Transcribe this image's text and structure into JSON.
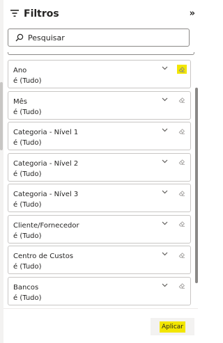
{
  "header": {
    "title": "Filtros",
    "collapse_icon": "double-chevron-right-icon",
    "filter_icon": "filter-icon"
  },
  "search": {
    "placeholder": "Pesquisar",
    "value": ""
  },
  "filters": [
    {
      "label": "Ano",
      "value": "é (Tudo)",
      "highlighted": true
    },
    {
      "label": "Mês",
      "value": "é (Tudo)",
      "highlighted": false
    },
    {
      "label": "Categoria - Nível 1",
      "value": "é (Tudo)",
      "highlighted": false
    },
    {
      "label": "Categoria - Nível 2",
      "value": "é (Tudo)",
      "highlighted": false
    },
    {
      "label": "Categoria - Nível 3",
      "value": "é (Tudo)",
      "highlighted": false
    },
    {
      "label": "Cliente/Fornecedor",
      "value": "é (Tudo)",
      "highlighted": false
    },
    {
      "label": "Centro de Custos",
      "value": "é (Tudo)",
      "highlighted": false
    },
    {
      "label": "Bancos",
      "value": "é (Tudo)",
      "highlighted": false
    }
  ],
  "footer": {
    "apply_label": "Aplicar"
  },
  "colors": {
    "highlight": "#f2e600",
    "text": "#252423",
    "border": "#c8c6c4",
    "icon": "#a19f9d"
  }
}
